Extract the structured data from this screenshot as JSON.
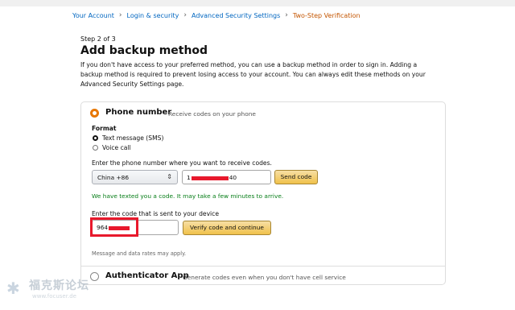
{
  "breadcrumb": [
    {
      "label": "Your Account"
    },
    {
      "label": "Login & security"
    },
    {
      "label": "Advanced Security Settings"
    },
    {
      "label": "Two-Step Verification"
    }
  ],
  "breadcrumb_separator": "›",
  "step_text": "Step 2 of 3",
  "title": "Add backup method",
  "intro": "If you don't have access to your preferred method, you can use a backup method in order to sign in. Adding a backup method is required to prevent losing access to your account. You can always edit these methods on your Advanced Security Settings page.",
  "phone_option": {
    "title": "Phone number",
    "subtitle": "Receive codes on your phone",
    "selected": true,
    "format_label": "Format",
    "formats": [
      {
        "label": "Text message (SMS)",
        "selected": true
      },
      {
        "label": "Voice call",
        "selected": false
      }
    ],
    "phone_prompt": "Enter the phone number where you want to receive codes.",
    "country": "China +86",
    "phone_prefix": "1",
    "phone_suffix": "40",
    "send_code_label": "Send code",
    "sent_message": "We have texted you a code. It may take a few minutes to arrive.",
    "code_prompt": "Enter the code that is sent to your device",
    "code_value": "964",
    "verify_label": "Verify code and continue",
    "fineprint": "Message and data rates may apply."
  },
  "authenticator_option": {
    "title": "Authenticator App",
    "subtitle": "Generate codes even when you don't have cell service",
    "selected": false
  },
  "watermark": {
    "cn_text": "福克斯论坛",
    "url": "www.focuser.de"
  },
  "colors": {
    "link": "#0066c0",
    "current_crumb": "#c45500",
    "radio_accent": "#e77600",
    "success": "#067d17",
    "annotation_red": "#e8192c"
  }
}
